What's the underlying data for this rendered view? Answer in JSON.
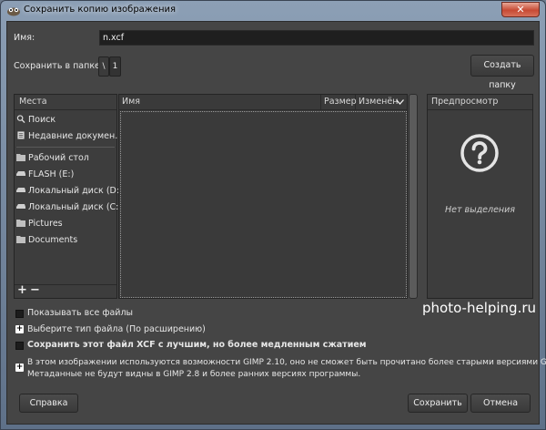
{
  "window": {
    "title": "Сохранить копию изображения",
    "close_symbol": "✕"
  },
  "name_field": {
    "label": "Имя:",
    "value": "n.xcf"
  },
  "folder": {
    "label": "Сохранить в папке",
    "path_root": "\\",
    "path_item": "1",
    "create_folder_button": "Создать папку"
  },
  "places": {
    "header": "Места",
    "items": [
      {
        "label": "Поиск",
        "icon": "search-icon"
      },
      {
        "label": "Недавние докумен...",
        "icon": "recent-documents-icon"
      },
      {
        "label": "Рабочий стол",
        "icon": "folder-icon"
      },
      {
        "label": "FLASH (E:)",
        "icon": "drive-icon"
      },
      {
        "label": "Локальный диск (D:)",
        "icon": "drive-icon"
      },
      {
        "label": "Локальный диск (C:)",
        "icon": "drive-icon"
      },
      {
        "label": "Pictures",
        "icon": "folder-icon"
      },
      {
        "label": "Documents",
        "icon": "folder-icon"
      }
    ],
    "add_symbol": "+",
    "remove_symbol": "−"
  },
  "files": {
    "col_name": "Имя",
    "col_size": "Размер",
    "col_modified": "Изменён"
  },
  "preview": {
    "header": "Предпросмотр",
    "empty_text": "Нет выделения"
  },
  "options": {
    "show_all_files": "Показывать все файлы",
    "select_file_type": "Выберите тип файла (По расширению)",
    "better_compression": "Сохранить этот файл XCF с лучшим, но более медленным сжатием",
    "compat_notice_line1": "В этом изображении используются возможности GIMP 2.10, оно не сможет быть прочитано более старыми версиями GIMP.",
    "compat_notice_line2": "Метаданные не будут видны в GIMP 2.8 и более ранних версиях программы."
  },
  "watermark": "photo-helping.ru",
  "buttons": {
    "help": "Справка",
    "save": "Сохранить",
    "cancel": "Отмена"
  },
  "colors": {
    "dialog_bg": "#454545",
    "close_button": "#c74a34",
    "title_bar": "#8c9fb5"
  }
}
